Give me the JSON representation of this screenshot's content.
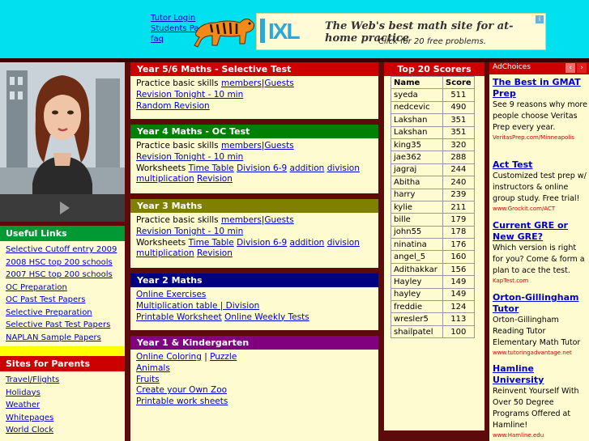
{
  "header": {
    "links": [
      "Tutor Login",
      "Students Page",
      "faq"
    ],
    "ad": {
      "brand": "IXL",
      "headline": "The Web's best math site for at-home practice",
      "cta": "Click for 20 free problems."
    }
  },
  "left": {
    "useful_title": "Useful Links",
    "useful_links": [
      "Selective Cutoff entry 2009",
      "2008 HSC top 200 schools",
      "2007 HSC top 200 schools",
      "OC Preparation",
      "OC Past Test Papers",
      "Selective Preparation",
      "Selective Past Test Papers",
      "NAPLAN Sample Papers"
    ],
    "parents_title": "Sites for Parents",
    "parents_links": [
      "Travel/Flights",
      "Holidays",
      "Weather",
      "Whitepages",
      "World Clock"
    ]
  },
  "sections": {
    "s56": {
      "title": "Year 5/6 Maths - Selective Test",
      "practice": "Practice basic skills",
      "members": "members",
      "sep": "|",
      "guests": "Guests",
      "revision": "Revision Tonight - 10 min",
      "random": "Random Revision"
    },
    "s4": {
      "title": "Year 4 Maths - OC Test",
      "practice": "Practice basic skills",
      "members": "members",
      "sep": "|",
      "guests": "Guests",
      "revision": "Revision Tonight - 10 min",
      "worksheets": "Worksheets",
      "ws_links": [
        "Time Table",
        "Division 6-9",
        "addition",
        "division",
        "multiplication",
        "Revision"
      ]
    },
    "s3": {
      "title": "Year 3 Maths",
      "practice": "Practice basic skills",
      "members": "members",
      "sep": "|",
      "guests": "Guests",
      "revision": "Revision Tonight - 10 min",
      "worksheets": "Worksheets",
      "ws_links": [
        "Time Table",
        "Division 6-9",
        "addition",
        "division",
        "multiplication",
        "Revision"
      ]
    },
    "s2": {
      "title": "Year 2 Maths",
      "online": "Online Exercises",
      "mult": "Multiplication table | Division",
      "printable": "Printable Worksheet",
      "weekly": "Online Weekly Tests"
    },
    "s1": {
      "title": "Year 1 & Kindergarten",
      "coloring": "Online Coloring",
      "sep": "|",
      "puzzle": "Puzzle",
      "animals": "Animals",
      "fruits": "Fruits",
      "zoo": "Create your Own Zoo",
      "sheets": "Printable work sheets"
    }
  },
  "scores": {
    "title": "Top 20 Scorers",
    "col_name": "Name",
    "col_score": "Score",
    "rows": [
      [
        "syeda",
        "511"
      ],
      [
        "nedcevic",
        "490"
      ],
      [
        "Lakshan",
        "351"
      ],
      [
        "Lakshan",
        "351"
      ],
      [
        "king35",
        "320"
      ],
      [
        "jae362",
        "288"
      ],
      [
        "jagraj",
        "244"
      ],
      [
        "Abitha",
        "240"
      ],
      [
        "harry",
        "239"
      ],
      [
        "kylie",
        "211"
      ],
      [
        "bille",
        "179"
      ],
      [
        "john55",
        "178"
      ],
      [
        "ninatina",
        "176"
      ],
      [
        "angel_5",
        "160"
      ],
      [
        "Adithakkar",
        "156"
      ],
      [
        "Hayley",
        "149"
      ],
      [
        "hayley",
        "149"
      ],
      [
        "freddie",
        "124"
      ],
      [
        "wresler5",
        "113"
      ],
      [
        "shailpatel",
        "100"
      ]
    ]
  },
  "ads": {
    "label": "AdChoices",
    "items": [
      {
        "title": "The Best in GMAT Prep",
        "body": "See 9 reasons why more people choose Veritas Prep every year.",
        "url": "VeritasPrep.com/Minneapolis"
      },
      {
        "title": "Act Test",
        "body": "Customized test prep w/ instructors & online group study. Free trial!",
        "url": "www.Grockit.com/ACT"
      },
      {
        "title": "Current GRE or New GRE?",
        "body": "Which version is right for you? Come & form a plan to ace the test.",
        "url": "KapTest.com"
      },
      {
        "title": "Orton-Gillingham Tutor",
        "body": "Orton-Gillingham Reading Tutor Elementary Math Tutor",
        "url": "www.tutoringadvantage.net"
      },
      {
        "title": "Hamline University",
        "body": "Reinvent Yourself With Over 50 Degree Programs Offered at Hamline!",
        "url": "www.Hamline.edu"
      }
    ]
  }
}
